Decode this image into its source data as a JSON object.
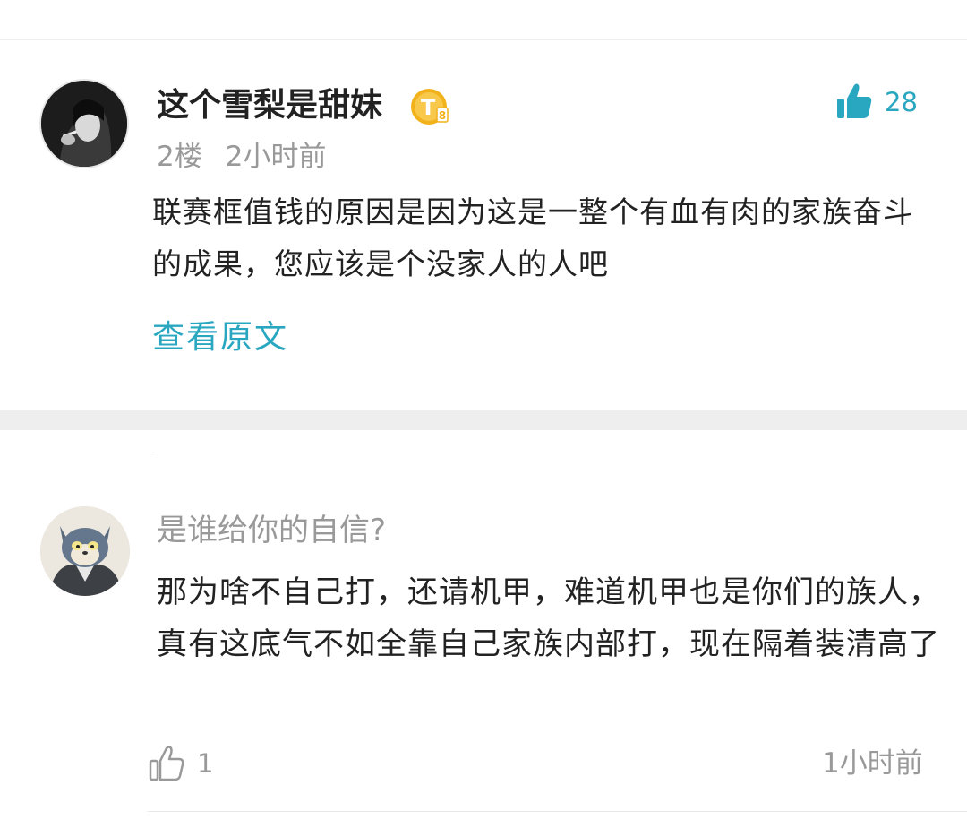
{
  "comment": {
    "username": "这个雪梨是甜妹",
    "badge_letter": "T",
    "badge_level": "8",
    "like_count": "28",
    "floor": "2楼",
    "time": "2小时前",
    "content": "联赛框值钱的原因是因为这是一整个有血有肉的家族奋斗的成果，您应该是个没家人的人吧",
    "view_original_label": "查看原文"
  },
  "reply": {
    "quoted_text": "是谁给你的自信?",
    "content": "那为啥不自己打，还请机甲，难道机甲也是你们的族人，真有这底气不如全靠自己家族内部打，现在隔着装清高了",
    "like_count": "1",
    "time": "1小时前"
  },
  "colors": {
    "accent": "#2aa7c0",
    "text_primary": "#222222",
    "text_secondary": "#999999",
    "divider": "#eeeeee",
    "badge_gold": "#f2b21c"
  },
  "icons": {
    "like_active": "thumbs-up-icon",
    "like_inactive": "thumbs-up-outline-icon",
    "badge": "level-badge-icon"
  }
}
